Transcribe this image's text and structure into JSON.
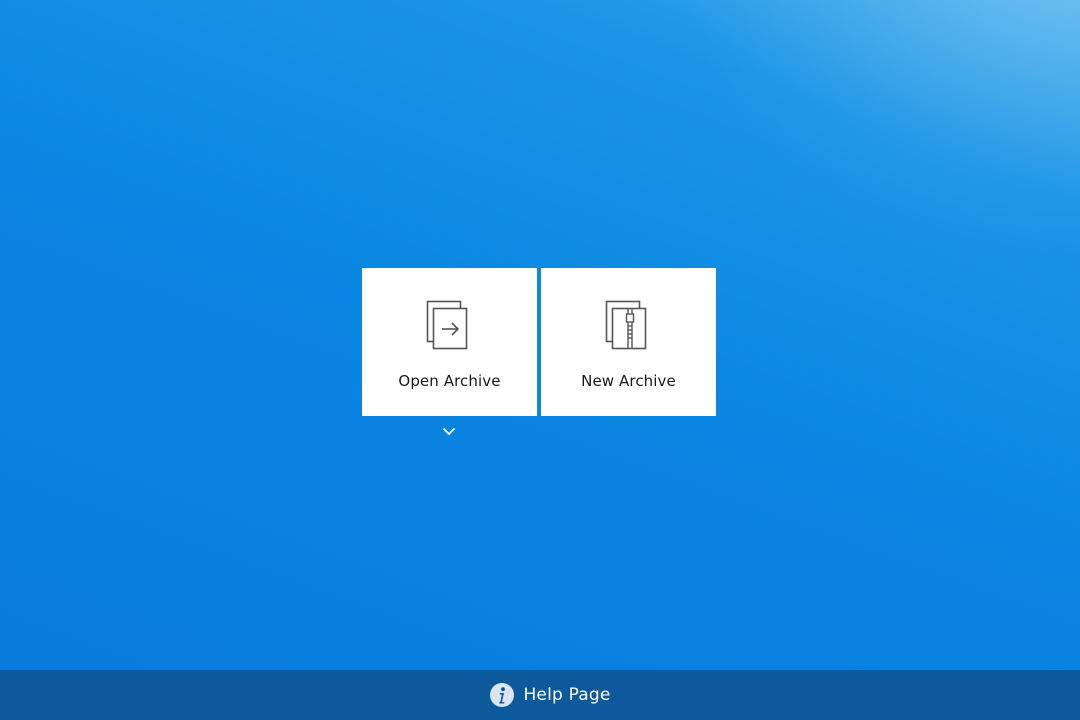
{
  "tiles": {
    "open_archive": {
      "label": "Open Archive",
      "icon": "open-archive-icon"
    },
    "new_archive": {
      "label": "New Archive",
      "icon": "new-archive-icon"
    }
  },
  "open_dropdown": {
    "icon": "chevron-down-icon"
  },
  "footer": {
    "help_label": "Help Page",
    "help_icon": "info-icon"
  },
  "colors": {
    "background": "#0a84e0",
    "tile": "#ffffff",
    "footer": "#0c5a9c",
    "footer_text": "#ffffff"
  }
}
